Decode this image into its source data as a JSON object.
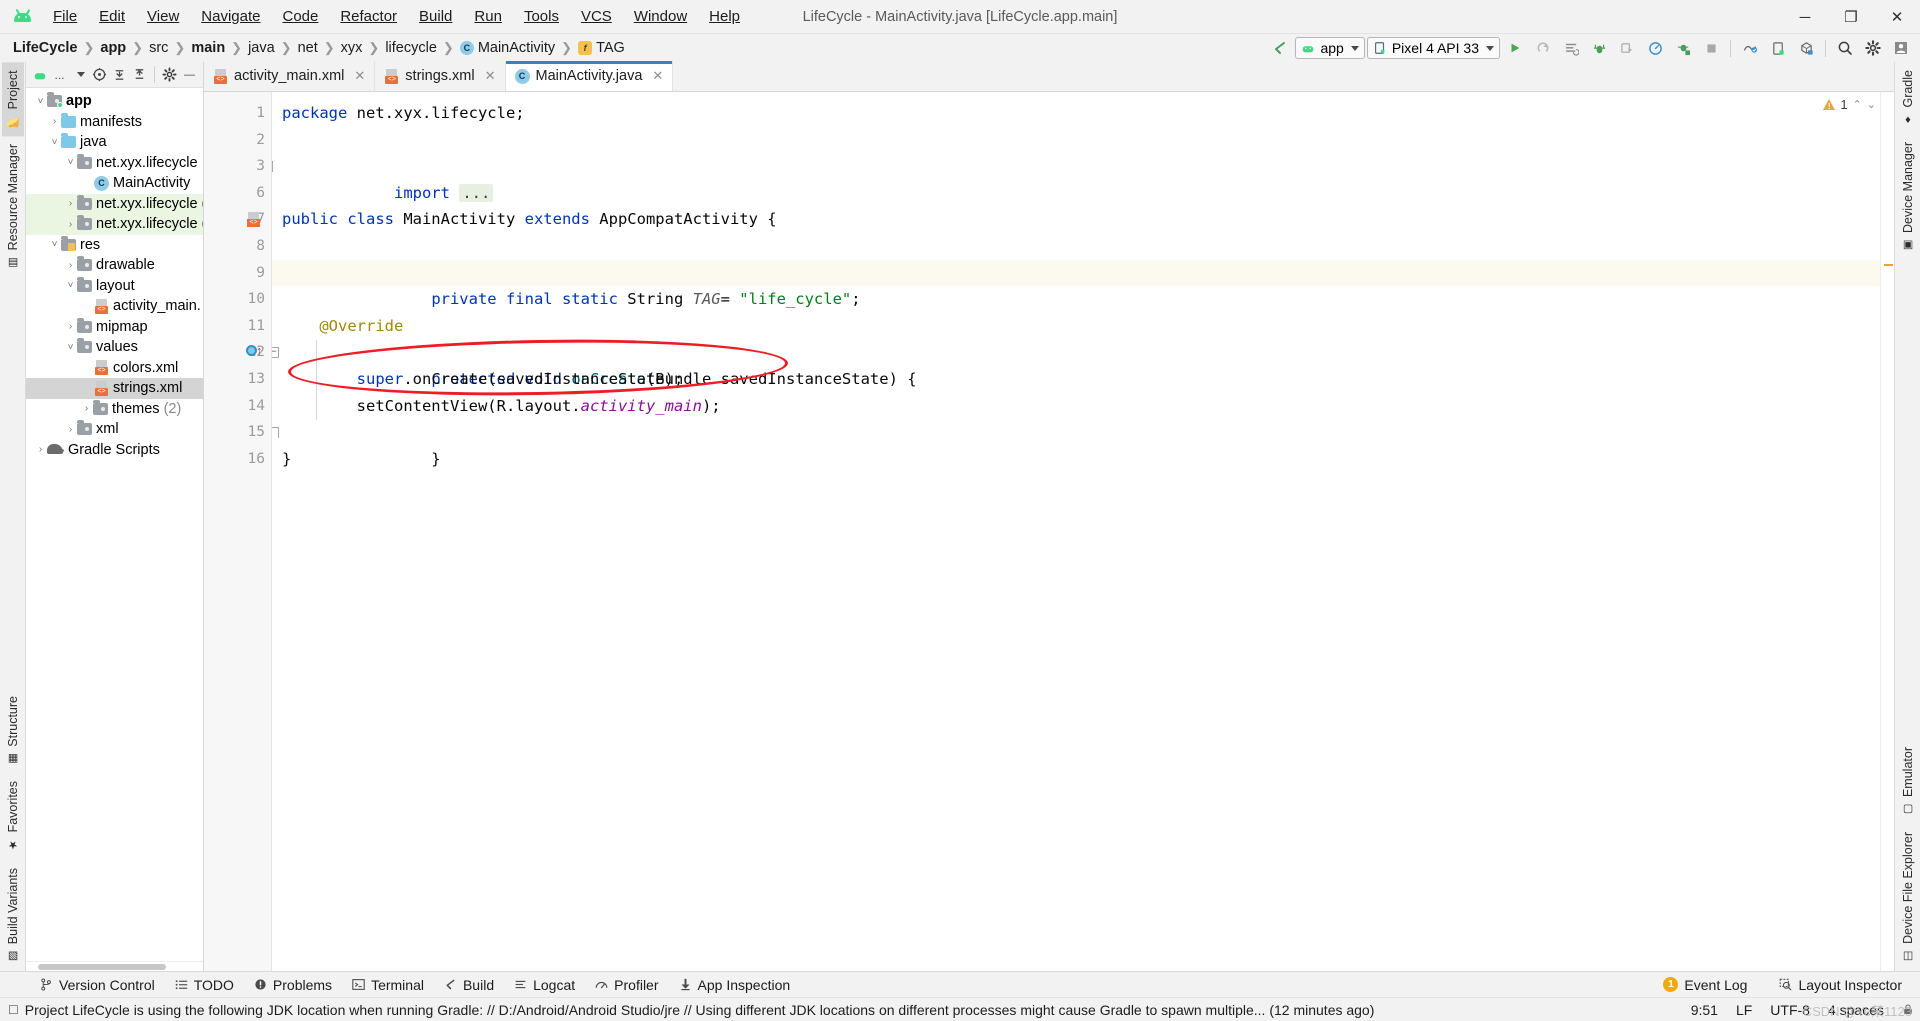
{
  "window": {
    "title": "LifeCycle - MainActivity.java [LifeCycle.app.main]",
    "minimize": "─",
    "maximize": "❐",
    "close": "✕"
  },
  "menu": [
    {
      "label": "File"
    },
    {
      "label": "Edit"
    },
    {
      "label": "View"
    },
    {
      "label": "Navigate"
    },
    {
      "label": "Code"
    },
    {
      "label": "Refactor"
    },
    {
      "label": "Build"
    },
    {
      "label": "Run"
    },
    {
      "label": "Tools"
    },
    {
      "label": "VCS"
    },
    {
      "label": "Window"
    },
    {
      "label": "Help"
    }
  ],
  "breadcrumbs": [
    {
      "label": "LifeCycle",
      "bold": true,
      "icon": ""
    },
    {
      "label": "app",
      "bold": true,
      "icon": ""
    },
    {
      "label": "src",
      "bold": false,
      "icon": ""
    },
    {
      "label": "main",
      "bold": true,
      "icon": ""
    },
    {
      "label": "java",
      "bold": false,
      "icon": ""
    },
    {
      "label": "net",
      "bold": false,
      "icon": ""
    },
    {
      "label": "xyx",
      "bold": false,
      "icon": ""
    },
    {
      "label": "lifecycle",
      "bold": false,
      "icon": ""
    },
    {
      "label": "MainActivity",
      "bold": false,
      "icon": "class-icon"
    },
    {
      "label": "TAG",
      "bold": false,
      "icon": "field-icon"
    }
  ],
  "run_toolbar": {
    "back_arrow": "back-arrow-icon",
    "module_config": "app",
    "device": "Pixel 4 API 33",
    "run_button": "run-icon",
    "apply_changes": "apply-changes-icon",
    "apply_code_changes": "apply-code-changes-icon",
    "debug": "debug-icon",
    "attach_debugger": "attach-debugger-icon",
    "profiler": "profiler-icon",
    "run_with_coverage": "run-coverage-icon",
    "stop": "stop-icon",
    "device_manager": "device-manager-icon",
    "device_file_explorer": "device-explorer-icon",
    "sdk_manager": "sdk-manager-icon",
    "search": "search-icon",
    "settings": "gear-icon",
    "account": "account-icon"
  },
  "left_tool_tabs": [
    {
      "label": "Project",
      "active": true,
      "icon": "folder-icon"
    },
    {
      "label": "Resource Manager",
      "active": false,
      "icon": "resource-icon"
    }
  ],
  "left_tool_tabs_bottom": [
    {
      "label": "Structure",
      "active": false,
      "icon": "structure-icon"
    },
    {
      "label": "Favorites",
      "active": false,
      "icon": "star-icon"
    },
    {
      "label": "Build Variants",
      "active": false,
      "icon": "variants-icon"
    }
  ],
  "right_tool_tabs": [
    {
      "label": "Gradle",
      "icon": "gradle-icon"
    },
    {
      "label": "Device Manager",
      "icon": "device-manager-icon"
    }
  ],
  "right_tool_tabs_bottom": [
    {
      "label": "Emulator",
      "icon": "emulator-icon"
    },
    {
      "label": "Device File Explorer",
      "icon": "device-file-icon"
    }
  ],
  "project_toolbar": {
    "scope": "...",
    "locate": "locate-icon",
    "expand_all": "expand-all-icon",
    "collapse_all": "collapse-all-icon",
    "settings": "gear-icon",
    "hide": "hide-icon"
  },
  "tree": [
    {
      "label": "app",
      "depth": 0,
      "twisty": "v",
      "icon": "folder-app",
      "bold": true,
      "state": ""
    },
    {
      "label": "manifests",
      "depth": 1,
      "twisty": ">",
      "icon": "folder-blue",
      "bold": false,
      "state": ""
    },
    {
      "label": "java",
      "depth": 1,
      "twisty": "v",
      "icon": "folder-blue",
      "bold": false,
      "state": ""
    },
    {
      "label": "net.xyx.lifecycle",
      "depth": 2,
      "twisty": "v",
      "icon": "folder-pkg",
      "bold": false,
      "state": ""
    },
    {
      "label": "MainActivity",
      "depth": 3,
      "twisty": "",
      "icon": "java-class",
      "bold": false,
      "state": ""
    },
    {
      "label": "net.xyx.lifecycle (",
      "depth": 2,
      "twisty": ">",
      "icon": "folder-pkg",
      "bold": false,
      "state": "hl"
    },
    {
      "label": "net.xyx.lifecycle (",
      "depth": 2,
      "twisty": ">",
      "icon": "folder-pkg",
      "bold": false,
      "state": "hl"
    },
    {
      "label": "res",
      "depth": 1,
      "twisty": "v",
      "icon": "folder-res",
      "bold": false,
      "state": ""
    },
    {
      "label": "drawable",
      "depth": 2,
      "twisty": ">",
      "icon": "folder-pkg",
      "bold": false,
      "state": ""
    },
    {
      "label": "layout",
      "depth": 2,
      "twisty": "v",
      "icon": "folder-pkg",
      "bold": false,
      "state": ""
    },
    {
      "label": "activity_main.",
      "depth": 3,
      "twisty": "",
      "icon": "xml-file",
      "bold": false,
      "state": ""
    },
    {
      "label": "mipmap",
      "depth": 2,
      "twisty": ">",
      "icon": "folder-pkg",
      "bold": false,
      "state": ""
    },
    {
      "label": "values",
      "depth": 2,
      "twisty": "v",
      "icon": "folder-pkg",
      "bold": false,
      "state": ""
    },
    {
      "label": "colors.xml",
      "depth": 3,
      "twisty": "",
      "icon": "xml-file",
      "bold": false,
      "state": ""
    },
    {
      "label": "strings.xml",
      "depth": 3,
      "twisty": "",
      "icon": "xml-file",
      "bold": false,
      "state": "sel"
    },
    {
      "label": "themes",
      "depth": 3,
      "twisty": ">",
      "icon": "folder-pkg",
      "bold": false,
      "state": "",
      "suffix": "(2)"
    },
    {
      "label": "xml",
      "depth": 2,
      "twisty": ">",
      "icon": "folder-pkg",
      "bold": false,
      "state": ""
    },
    {
      "label": "Gradle Scripts",
      "depth": 0,
      "twisty": ">",
      "icon": "gradle",
      "bold": false,
      "state": ""
    }
  ],
  "editor_tabs": [
    {
      "label": "activity_main.xml",
      "icon": "xml-file-icon",
      "active": false,
      "close": "✕"
    },
    {
      "label": "strings.xml",
      "icon": "xml-file-icon",
      "active": false,
      "close": "✕"
    },
    {
      "label": "MainActivity.java",
      "icon": "java-class-icon",
      "active": true,
      "close": "✕"
    }
  ],
  "editor": {
    "line_numbers": [
      "1",
      "2",
      "3",
      "6",
      "7",
      "8",
      "9",
      "10",
      "11",
      "12",
      "13",
      "14",
      "15",
      "16"
    ],
    "lines": [
      {
        "n": "1",
        "html": "<span class='kw'>package</span><span class='plain'> net.xyx.lifecycle;</span>",
        "hl": false
      },
      {
        "n": "2",
        "html": "",
        "hl": false
      },
      {
        "n": "3",
        "html": "<span class='kw'>import</span><span class='plain'> </span><span class='fold-chip'>...</span>",
        "hl": false
      },
      {
        "n": "6",
        "html": "",
        "hl": false
      },
      {
        "n": "7",
        "html": "<span class='kw'>public class</span><span class='plain'> MainActivity </span><span class='kw'>extends</span><span class='plain'> AppCompatActivity {</span>",
        "hl": false
      },
      {
        "n": "8",
        "html": "",
        "hl": false
      },
      {
        "n": "9",
        "html": "<span class='plain'>    </span><span class='kw'>private final static</span><span class='plain'> String </span><span class='fld'>TAG</span><span class='plain'>= </span><span class='str'>\"life_cycle\"</span><span class='plain'>;</span>",
        "hl": true
      },
      {
        "n": "10",
        "html": "",
        "hl": false
      },
      {
        "n": "11",
        "html": "<span class='plain'>    </span><span class='ann'>@Override</span>",
        "hl": false
      },
      {
        "n": "12",
        "html": "<span class='plain'>    </span><span class='kw'>protected void</span><span class='plain'> </span><span class='mth'>onCreate</span><span class='plain'>(Bundle savedInstanceState) {</span>",
        "hl": false
      },
      {
        "n": "13",
        "html": "<span class='plain'>        </span><span class='kw'>super</span><span class='plain'>.onCreate(savedInstanceState);</span>",
        "hl": false
      },
      {
        "n": "14",
        "html": "<span class='plain'>        setContentView(R.layout.</span><span class='const'>activity_main</span><span class='plain'>);</span>",
        "hl": false
      },
      {
        "n": "15",
        "html": "<span class='plain'>    }</span>",
        "hl": false
      },
      {
        "n": "16",
        "html": "<span class='plain'>}</span>",
        "hl": false
      }
    ],
    "plain_text": [
      "package net.xyx.lifecycle;",
      "",
      "import ...",
      "",
      "public class MainActivity extends AppCompatActivity {",
      "",
      "    private final static String TAG= \"life_cycle\";",
      "",
      "    @Override",
      "    protected void onCreate(Bundle savedInstanceState) {",
      "        super.onCreate(savedInstanceState);",
      "        setContentView(R.layout.activity_main);",
      "    }",
      "}"
    ]
  },
  "inspection": {
    "warning_count": "1",
    "up_chevron": "⌃",
    "down_chevron": "⌄"
  },
  "annotation": {
    "shape": "red-ellipse",
    "color": "#ee1c25",
    "target_line": "9"
  },
  "bottom_tools": [
    {
      "label": "Version Control",
      "icon": "branch-icon"
    },
    {
      "label": "TODO",
      "icon": "todo-icon"
    },
    {
      "label": "Problems",
      "icon": "problems-icon"
    },
    {
      "label": "Terminal",
      "icon": "terminal-icon"
    },
    {
      "label": "Build",
      "icon": "build-icon"
    },
    {
      "label": "Logcat",
      "icon": "logcat-icon"
    },
    {
      "label": "Profiler",
      "icon": "profiler-icon"
    },
    {
      "label": "App Inspection",
      "icon": "app-inspection-icon"
    }
  ],
  "bottom_right": {
    "event_log": "Event Log",
    "event_log_count": "1",
    "layout_inspector": "Layout Inspector"
  },
  "status": {
    "message": "Project LifeCycle is using the following JDK location when running Gradle: // D:/Android/Android Studio/jre // Using different JDK locations on different processes might cause Gradle to spawn multiple... (12 minutes ago)",
    "caret": "9:51",
    "line_separator": "LF",
    "encoding": "UTF-8",
    "indent": "4 spaces",
    "lock": "lock-icon",
    "watermark": "CSDN @Ye某1123"
  },
  "colors": {
    "accent": "#3d7ecc",
    "android_green": "#3ddc84",
    "keyword": "#0033b3",
    "string": "#067d17",
    "annotation": "#9e880d",
    "constant": "#871094",
    "method": "#00627a",
    "highlight_line": "#fcfaef",
    "selection": "#d4d4d4",
    "tree_highlight": "#eaf5e2",
    "warning": "#e8a33d",
    "annotation_red": "#ee1c25"
  }
}
